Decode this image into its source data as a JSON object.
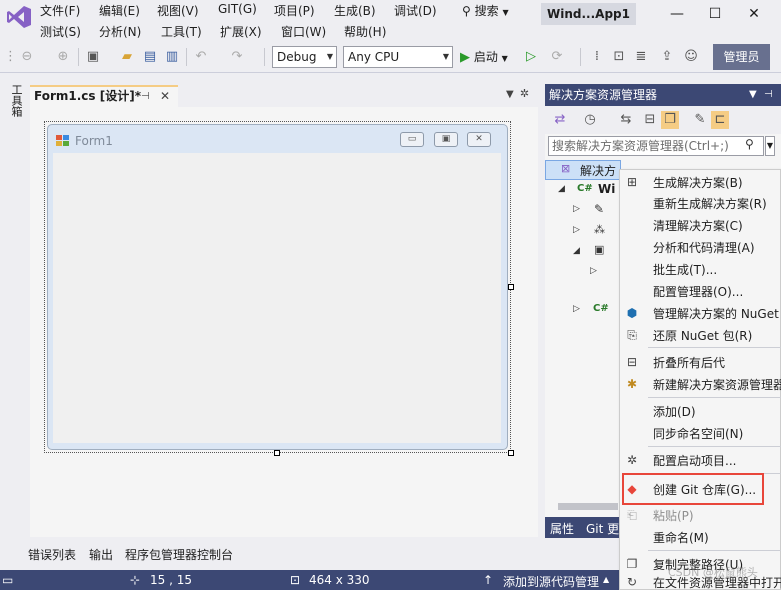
{
  "menus": {
    "row1": [
      "文件(F)",
      "编辑(E)",
      "视图(V)",
      "GIT(G)",
      "项目(P)",
      "生成(B)",
      "调试(D)"
    ],
    "row2": [
      "测试(S)",
      "分析(N)",
      "工具(T)",
      "扩展(X)",
      "窗口(W)",
      "帮助(H)"
    ]
  },
  "search_menu": "搜索",
  "window_title": "Wind...App1",
  "toolbar": {
    "config": "Debug",
    "platform": "Any CPU",
    "start": "启动",
    "admin": "管理员"
  },
  "toolbox_label": "工具箱",
  "doc_tab": {
    "title": "Form1.cs [设计]*"
  },
  "designer": {
    "form_title": "Form1"
  },
  "bottom_tabs": [
    "错误列表",
    "输出",
    "程序包管理器控制台"
  ],
  "status": {
    "position": "15 , 15",
    "size": "464 x 330",
    "add_source": "添加到源代码管理"
  },
  "solution_explorer": {
    "title": "解决方案资源管理器",
    "search_placeholder": "搜索解决方案资源管理器(Ctrl+;)",
    "root_label": "解决方",
    "project_label": "Wi",
    "bottom_tabs": [
      "属性",
      "Git 更"
    ]
  },
  "context_menu": {
    "items": [
      "生成解决方案(B)",
      "重新生成解决方案(R)",
      "清理解决方案(C)",
      "分析和代码清理(A)",
      "批生成(T)...",
      "配置管理器(O)...",
      "管理解决方案的 NuGet",
      "还原 NuGet 包(R)",
      "折叠所有后代",
      "新建解决方案资源管理器",
      "添加(D)",
      "同步命名空间(N)",
      "配置启动项目...",
      "创建 Git 仓库(G)...",
      "粘贴(P)",
      "重命名(M)",
      "复制完整路径(U)",
      "在文件资源管理器中打开"
    ]
  },
  "watermark": "CSDN @松鼠熊头",
  "colors": {
    "accent": "#3c4874",
    "highlight_border": "#e8463a",
    "vs_purple": "#8661c5"
  }
}
